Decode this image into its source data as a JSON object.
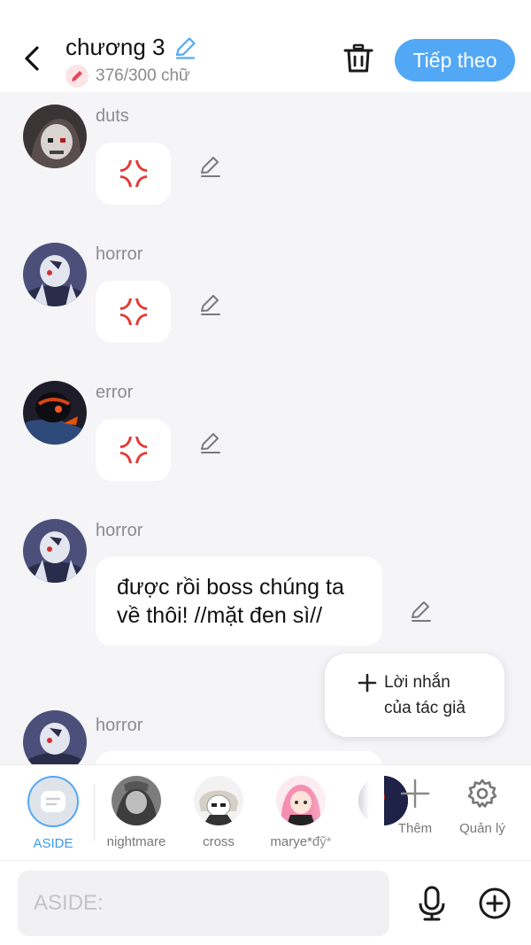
{
  "header": {
    "title": "chương 3",
    "word_count": "376/300 chữ",
    "next_label": "Tiếp theo"
  },
  "messages": [
    {
      "name": "duts",
      "content": "anger-emoji"
    },
    {
      "name": "horror",
      "content": "anger-emoji"
    },
    {
      "name": "error",
      "content": "anger-emoji"
    },
    {
      "name": "horror",
      "text": "được rồi boss chúng ta về thôi! //mặt đen sì//"
    },
    {
      "name": "horror"
    }
  ],
  "author_note": {
    "line1": "Lời nhắn",
    "line2": "của tác giả"
  },
  "characters": [
    {
      "label": "ASIDE",
      "active": true
    },
    {
      "label": "nightmare"
    },
    {
      "label": "cross"
    },
    {
      "label": "marye*đỹ*"
    }
  ],
  "tools": {
    "add_label": "Thêm",
    "manage_label": "Quản lý"
  },
  "input": {
    "placeholder": "ASIDE:"
  },
  "colors": {
    "accent": "#52a8f5",
    "anger": "#e53935",
    "background": "#f5f5f7"
  }
}
